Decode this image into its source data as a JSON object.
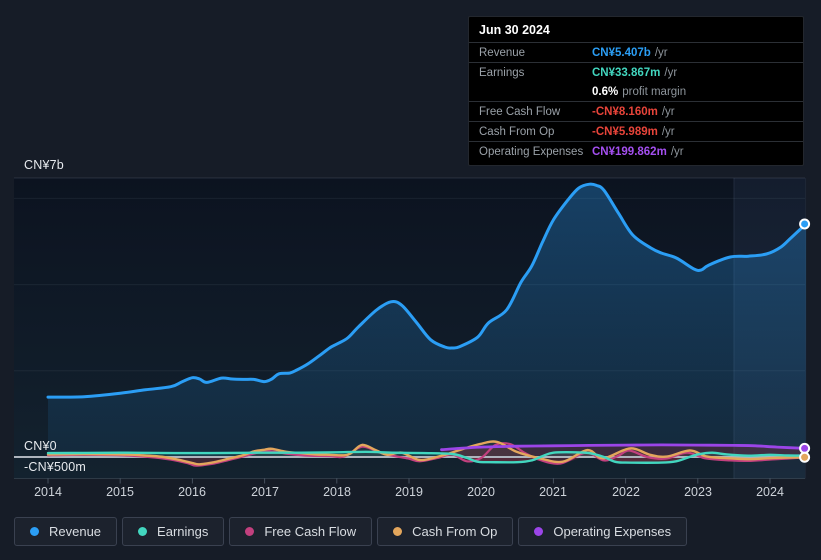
{
  "tooltip": {
    "date": "Jun 30 2024",
    "rows": [
      {
        "label": "Revenue",
        "value": "CN¥5.407b",
        "suffix": "/yr",
        "color": "#2b9ef5"
      },
      {
        "label": "Earnings",
        "value": "CN¥33.867m",
        "suffix": "/yr",
        "color": "#42d6bf"
      },
      {
        "label": "",
        "value": "0.6%",
        "suffix": "profit margin",
        "color": "#ffffff"
      },
      {
        "label": "Free Cash Flow",
        "value": "-CN¥8.160m",
        "suffix": "/yr",
        "color": "#e8443a"
      },
      {
        "label": "Cash From Op",
        "value": "-CN¥5.989m",
        "suffix": "/yr",
        "color": "#e8443a"
      },
      {
        "label": "Operating Expenses",
        "value": "CN¥199.862m",
        "suffix": "/yr",
        "color": "#a44ff0"
      }
    ]
  },
  "y_axis": {
    "top_label": "CN¥7b",
    "zero_label": "CN¥0",
    "neg_label": "-CN¥500m"
  },
  "legend": [
    {
      "label": "Revenue",
      "color": "#2b9ef5"
    },
    {
      "label": "Earnings",
      "color": "#42d6bf"
    },
    {
      "label": "Free Cash Flow",
      "color": "#c2407e"
    },
    {
      "label": "Cash From Op",
      "color": "#e3a65c"
    },
    {
      "label": "Operating Expenses",
      "color": "#9b45e8"
    }
  ],
  "chart_data": {
    "type": "line",
    "unit": "CN¥ billions",
    "x_ticks": [
      "2014",
      "2015",
      "2016",
      "2017",
      "2018",
      "2019",
      "2020",
      "2021",
      "2022",
      "2023",
      "2024"
    ],
    "x_range": [
      2014.0,
      2024.5
    ],
    "y_gridlines_b": [
      0,
      2,
      4,
      6
    ],
    "y_axis_labels_b": {
      "top": 7,
      "zero": 0,
      "neg": -0.5
    },
    "highlight_band_years": [
      2023.5,
      2024.5
    ],
    "series": [
      {
        "name": "Revenue",
        "color": "#2b9ef5",
        "points": [
          [
            2014.0,
            1.39
          ],
          [
            2014.5,
            1.4
          ],
          [
            2015.0,
            1.48
          ],
          [
            2015.35,
            1.56
          ],
          [
            2015.7,
            1.63
          ],
          [
            2015.85,
            1.74
          ],
          [
            2016.0,
            1.84
          ],
          [
            2016.1,
            1.81
          ],
          [
            2016.2,
            1.73
          ],
          [
            2016.4,
            1.83
          ],
          [
            2016.55,
            1.81
          ],
          [
            2016.7,
            1.8
          ],
          [
            2016.85,
            1.8
          ],
          [
            2017.0,
            1.75
          ],
          [
            2017.1,
            1.81
          ],
          [
            2017.2,
            1.93
          ],
          [
            2017.35,
            1.95
          ],
          [
            2017.45,
            2.02
          ],
          [
            2017.6,
            2.16
          ],
          [
            2017.75,
            2.34
          ],
          [
            2017.9,
            2.53
          ],
          [
            2018.0,
            2.62
          ],
          [
            2018.15,
            2.76
          ],
          [
            2018.3,
            3.02
          ],
          [
            2018.55,
            3.41
          ],
          [
            2018.75,
            3.6
          ],
          [
            2018.9,
            3.52
          ],
          [
            2019.1,
            3.13
          ],
          [
            2019.3,
            2.72
          ],
          [
            2019.5,
            2.55
          ],
          [
            2019.6,
            2.53
          ],
          [
            2019.7,
            2.56
          ],
          [
            2019.95,
            2.78
          ],
          [
            2020.1,
            3.11
          ],
          [
            2020.35,
            3.41
          ],
          [
            2020.55,
            4.05
          ],
          [
            2020.7,
            4.43
          ],
          [
            2020.85,
            4.99
          ],
          [
            2021.0,
            5.5
          ],
          [
            2021.2,
            5.96
          ],
          [
            2021.35,
            6.24
          ],
          [
            2021.5,
            6.33
          ],
          [
            2021.6,
            6.3
          ],
          [
            2021.7,
            6.19
          ],
          [
            2021.9,
            5.66
          ],
          [
            2022.1,
            5.15
          ],
          [
            2022.35,
            4.85
          ],
          [
            2022.5,
            4.73
          ],
          [
            2022.7,
            4.62
          ],
          [
            2022.95,
            4.36
          ],
          [
            2023.05,
            4.34
          ],
          [
            2023.15,
            4.45
          ],
          [
            2023.45,
            4.64
          ],
          [
            2023.7,
            4.66
          ],
          [
            2023.95,
            4.71
          ],
          [
            2024.15,
            4.87
          ],
          [
            2024.3,
            5.1
          ],
          [
            2024.5,
            5.407
          ]
        ]
      },
      {
        "name": "Earnings",
        "color": "#42d6bf",
        "points": [
          [
            2014.0,
            0.09
          ],
          [
            2014.5,
            0.095
          ],
          [
            2015.0,
            0.1
          ],
          [
            2015.5,
            0.095
          ],
          [
            2016.0,
            0.09
          ],
          [
            2016.5,
            0.095
          ],
          [
            2017.0,
            0.1
          ],
          [
            2017.5,
            0.1
          ],
          [
            2018.0,
            0.11
          ],
          [
            2018.4,
            0.12
          ],
          [
            2018.8,
            0.1
          ],
          [
            2019.2,
            0.09
          ],
          [
            2019.6,
            0.07
          ],
          [
            2019.8,
            -0.02
          ],
          [
            2019.95,
            -0.11
          ],
          [
            2020.1,
            -0.12
          ],
          [
            2020.5,
            -0.12
          ],
          [
            2020.7,
            -0.08
          ],
          [
            2020.85,
            0.02
          ],
          [
            2021.0,
            0.1
          ],
          [
            2021.3,
            0.11
          ],
          [
            2021.5,
            0.09
          ],
          [
            2021.7,
            0.0
          ],
          [
            2021.85,
            -0.11
          ],
          [
            2022.0,
            -0.13
          ],
          [
            2022.5,
            -0.13
          ],
          [
            2022.7,
            -0.1
          ],
          [
            2022.85,
            -0.02
          ],
          [
            2023.0,
            0.06
          ],
          [
            2023.2,
            0.1
          ],
          [
            2023.4,
            0.06
          ],
          [
            2023.7,
            0.03
          ],
          [
            2024.0,
            0.05
          ],
          [
            2024.25,
            0.035
          ],
          [
            2024.5,
            0.034
          ]
        ]
      },
      {
        "name": "Free Cash Flow",
        "color": "#c2407e",
        "points": [
          [
            2014.0,
            0.04
          ],
          [
            2014.5,
            0.05
          ],
          [
            2015.0,
            0.04
          ],
          [
            2015.4,
            0.0
          ],
          [
            2015.7,
            -0.06
          ],
          [
            2015.95,
            -0.15
          ],
          [
            2016.05,
            -0.2
          ],
          [
            2016.3,
            -0.15
          ],
          [
            2016.5,
            -0.07
          ],
          [
            2016.7,
            0.01
          ],
          [
            2016.9,
            0.1
          ],
          [
            2017.05,
            0.14
          ],
          [
            2017.3,
            0.08
          ],
          [
            2017.6,
            0.03
          ],
          [
            2017.9,
            0.02
          ],
          [
            2018.1,
            0.01
          ],
          [
            2018.35,
            0.24
          ],
          [
            2018.6,
            0.1
          ],
          [
            2018.8,
            0.02
          ],
          [
            2019.0,
            -0.04
          ],
          [
            2019.15,
            -0.1
          ],
          [
            2019.4,
            -0.02
          ],
          [
            2019.6,
            0.06
          ],
          [
            2019.8,
            -0.1
          ],
          [
            2020.0,
            -0.02
          ],
          [
            2020.2,
            0.28
          ],
          [
            2020.4,
            0.3
          ],
          [
            2020.6,
            0.1
          ],
          [
            2020.8,
            -0.06
          ],
          [
            2021.1,
            -0.15
          ],
          [
            2021.45,
            0.1
          ],
          [
            2021.7,
            -0.08
          ],
          [
            2021.9,
            0.03
          ],
          [
            2022.05,
            0.15
          ],
          [
            2022.3,
            0.0
          ],
          [
            2022.55,
            -0.04
          ],
          [
            2022.85,
            0.1
          ],
          [
            2023.1,
            -0.03
          ],
          [
            2023.45,
            -0.08
          ],
          [
            2023.7,
            -0.09
          ],
          [
            2024.1,
            -0.05
          ],
          [
            2024.5,
            -0.008
          ]
        ]
      },
      {
        "name": "Cash From Op",
        "color": "#e3a65c",
        "points": [
          [
            2014.0,
            0.06
          ],
          [
            2014.5,
            0.07
          ],
          [
            2015.0,
            0.06
          ],
          [
            2015.3,
            0.04
          ],
          [
            2015.6,
            0.0
          ],
          [
            2015.85,
            -0.08
          ],
          [
            2016.0,
            -0.14
          ],
          [
            2016.1,
            -0.17
          ],
          [
            2016.3,
            -0.12
          ],
          [
            2016.5,
            -0.04
          ],
          [
            2016.7,
            0.04
          ],
          [
            2016.85,
            0.13
          ],
          [
            2017.0,
            0.17
          ],
          [
            2017.1,
            0.19
          ],
          [
            2017.3,
            0.12
          ],
          [
            2017.5,
            0.09
          ],
          [
            2017.7,
            0.06
          ],
          [
            2017.9,
            0.05
          ],
          [
            2018.1,
            0.04
          ],
          [
            2018.2,
            0.09
          ],
          [
            2018.35,
            0.28
          ],
          [
            2018.55,
            0.15
          ],
          [
            2018.7,
            0.05
          ],
          [
            2018.9,
            0.1
          ],
          [
            2019.15,
            -0.07
          ],
          [
            2019.43,
            0.02
          ],
          [
            2019.7,
            0.16
          ],
          [
            2019.98,
            0.3
          ],
          [
            2020.22,
            0.35
          ],
          [
            2020.49,
            0.12
          ],
          [
            2020.81,
            -0.03
          ],
          [
            2021.13,
            -0.11
          ],
          [
            2021.47,
            0.16
          ],
          [
            2021.69,
            -0.03
          ],
          [
            2022.06,
            0.2
          ],
          [
            2022.34,
            0.05
          ],
          [
            2022.57,
            0.01
          ],
          [
            2022.89,
            0.15
          ],
          [
            2023.13,
            0.01
          ],
          [
            2023.45,
            -0.03
          ],
          [
            2023.72,
            -0.05
          ],
          [
            2024.07,
            -0.02
          ],
          [
            2024.5,
            -0.006
          ]
        ]
      },
      {
        "name": "Operating Expenses",
        "color": "#9b45e8",
        "points": [
          [
            2019.45,
            0.17
          ],
          [
            2019.7,
            0.2
          ],
          [
            2020.0,
            0.23
          ],
          [
            2020.5,
            0.25
          ],
          [
            2021.0,
            0.26
          ],
          [
            2021.5,
            0.27
          ],
          [
            2022.0,
            0.275
          ],
          [
            2022.5,
            0.28
          ],
          [
            2023.0,
            0.275
          ],
          [
            2023.5,
            0.27
          ],
          [
            2023.8,
            0.26
          ],
          [
            2024.1,
            0.23
          ],
          [
            2024.5,
            0.2
          ]
        ]
      }
    ],
    "end_markers": [
      {
        "series": "Revenue",
        "year": 2024.5,
        "value": 5.407
      },
      {
        "series": "Operating Expenses",
        "year": 2024.5,
        "value": 0.1998
      },
      {
        "series": "Cash From Op",
        "year": 2024.5,
        "value": -0.006
      }
    ]
  }
}
